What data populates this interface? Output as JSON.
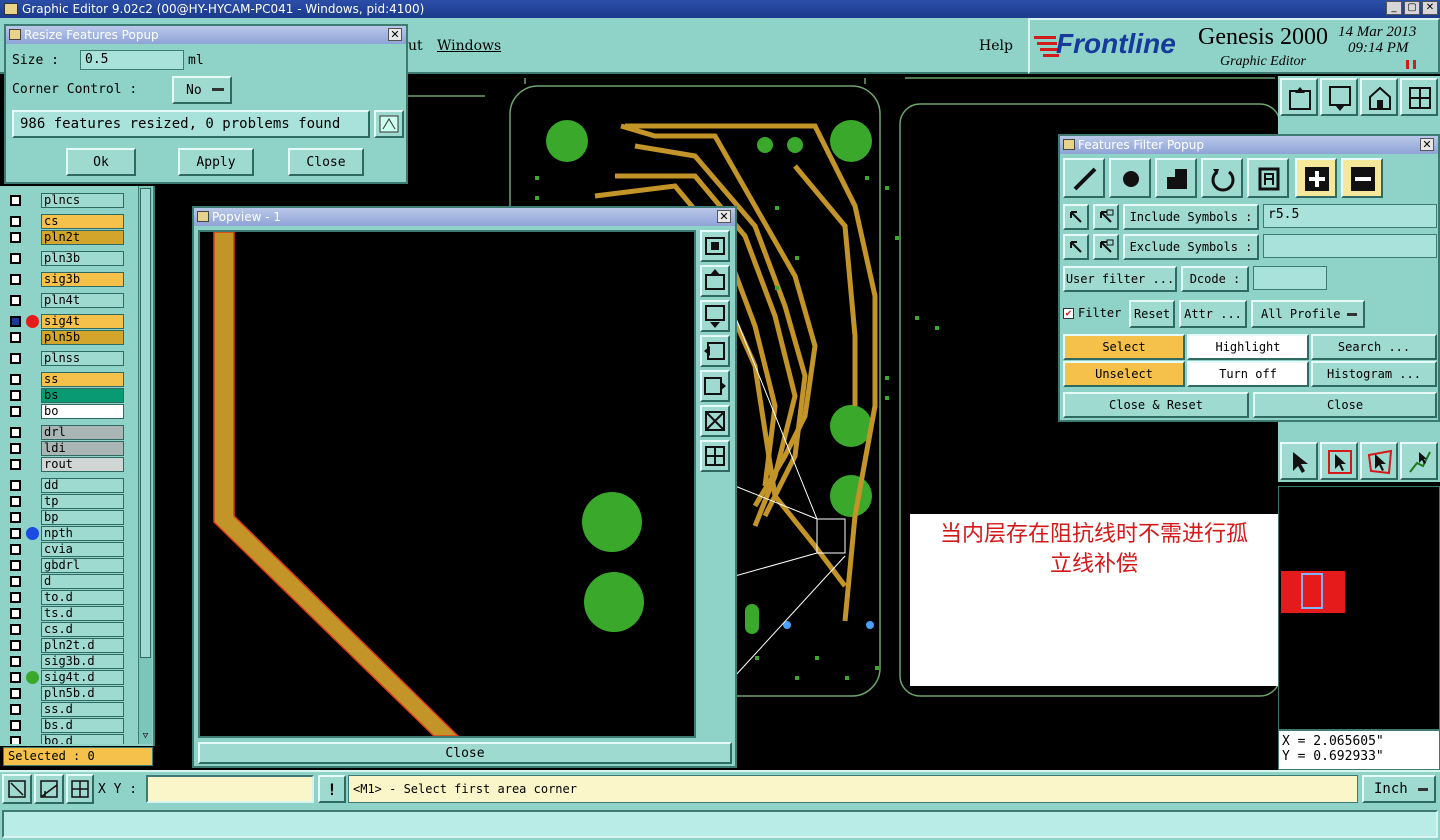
{
  "app": {
    "title": "Graphic Editor 9.02c2 (00@HY-HYCAM-PC041 - Windows, pid:4100)"
  },
  "menu": {
    "items": [
      "ut",
      "Windows"
    ],
    "help": "Help"
  },
  "brand": {
    "logo": "Frontline",
    "product": "Genesis 2000",
    "subtitle": "Graphic Editor",
    "date": "14 Mar 2013",
    "time": "09:14 PM"
  },
  "resize": {
    "title": "Resize Features Popup",
    "size_label": "Size :",
    "size_value": "0.5",
    "size_unit": "ml",
    "corner_label": "Corner Control :",
    "corner_value": "No",
    "status": "986 features resized, 0 problems found",
    "ok": "Ok",
    "apply": "Apply",
    "close": "Close"
  },
  "layers": [
    "plncs",
    "cs",
    "pln2t",
    "pln3b",
    "sig3b",
    "pln4t",
    "sig4t",
    "pln5b",
    "plnss",
    "ss",
    "bs",
    "bo",
    "drl",
    "ldi",
    "rout",
    "dd",
    "tp",
    "bp",
    "npth",
    "cvia",
    "gbdrl",
    "d",
    "to.d",
    "ts.d",
    "cs.d",
    "pln2t.d",
    "sig3b.d",
    "sig4t.d",
    "pln5b.d",
    "ss.d",
    "bs.d",
    "bo.d"
  ],
  "layer_colors": {
    "orange": "#f6c14a",
    "gold": "#d3a52b",
    "green": "#0a9a73",
    "gray": "#a9b6b4",
    "white": "#ffffff",
    "teal": "#9fdad1"
  },
  "selected": "Selected : 0",
  "popview": {
    "title": "Popview - 1",
    "close": "Close"
  },
  "filter": {
    "title": "Features Filter Popup",
    "include_label": "Include Symbols :",
    "include_value": "r5.5",
    "exclude_label": "Exclude Symbols :",
    "exclude_value": "",
    "user_filter": "User filter ...",
    "dcode_label": "Dcode :",
    "filter": "Filter",
    "reset": "Reset",
    "attr": "Attr ...",
    "profile": "All Profile",
    "select": "Select",
    "highlight": "Highlight",
    "search": "Search ...",
    "unselect": "Unselect",
    "turnoff": "Turn off",
    "histogram": "Histogram ...",
    "close_reset": "Close & Reset",
    "close": "Close"
  },
  "annotation": {
    "line1": "当内层存在阻抗线时不需进行孤",
    "line2": "立线补偿"
  },
  "coords": {
    "x": "X = 2.065605\"",
    "y": "Y = 0.692933\""
  },
  "status": {
    "xy_label": "X Y :",
    "prompt": "<M1> - Select first area corner",
    "unit": "Inch"
  }
}
